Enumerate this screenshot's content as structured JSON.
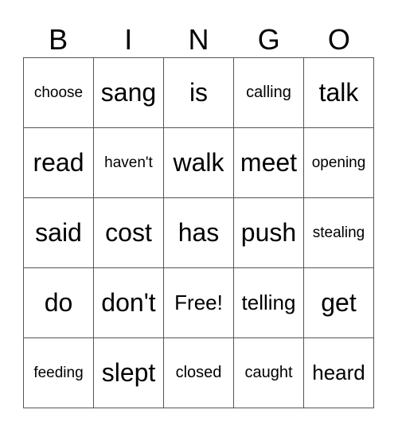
{
  "header": [
    "B",
    "I",
    "N",
    "G",
    "O"
  ],
  "rows": [
    [
      {
        "text": "choose",
        "size": "s-xs"
      },
      {
        "text": "sang",
        "size": "s-l"
      },
      {
        "text": "is",
        "size": "s-l"
      },
      {
        "text": "calling",
        "size": "s-s"
      },
      {
        "text": "talk",
        "size": "s-l"
      }
    ],
    [
      {
        "text": "read",
        "size": "s-l"
      },
      {
        "text": "haven't",
        "size": "s-xs"
      },
      {
        "text": "walk",
        "size": "s-l"
      },
      {
        "text": "meet",
        "size": "s-l"
      },
      {
        "text": "opening",
        "size": "s-xs"
      }
    ],
    [
      {
        "text": "said",
        "size": "s-l"
      },
      {
        "text": "cost",
        "size": "s-l"
      },
      {
        "text": "has",
        "size": "s-l"
      },
      {
        "text": "push",
        "size": "s-l"
      },
      {
        "text": "stealing",
        "size": "s-xs"
      }
    ],
    [
      {
        "text": "do",
        "size": "s-l"
      },
      {
        "text": "don't",
        "size": "s-l"
      },
      {
        "text": "Free!",
        "size": "s-m"
      },
      {
        "text": "telling",
        "size": "s-m"
      },
      {
        "text": "get",
        "size": "s-l"
      }
    ],
    [
      {
        "text": "feeding",
        "size": "s-xs"
      },
      {
        "text": "slept",
        "size": "s-l"
      },
      {
        "text": "closed",
        "size": "s-s"
      },
      {
        "text": "caught",
        "size": "s-s"
      },
      {
        "text": "heard",
        "size": "s-m"
      }
    ]
  ]
}
